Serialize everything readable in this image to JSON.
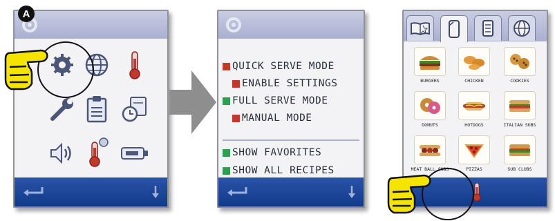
{
  "badge": "A",
  "screen2": {
    "menu_items": [
      {
        "label": "QUICK SERVE MODE",
        "color": "#c0392b",
        "indent": false
      },
      {
        "label": "ENABLE SETTINGS",
        "color": "#c0392b",
        "indent": true
      },
      {
        "label": "FULL SERVE MODE",
        "color": "#2e9e4f",
        "indent": false
      },
      {
        "label": "MANUAL MODE",
        "color": "#c0392b",
        "indent": true
      },
      {
        "label": "SHOW FAVORITES",
        "color": "#2e9e4f",
        "indent": false
      },
      {
        "label": "SHOW ALL RECIPES",
        "color": "#2e9e4f",
        "indent": false
      }
    ]
  },
  "screen3": {
    "recipes": [
      "BURGERS",
      "CHICKEN",
      "COOKIES",
      "DONUTS",
      "HOTDOGS",
      "ITALIAN SUBS",
      "MEAT BALL SUBS",
      "PIZZAS",
      "SUB CLUBS"
    ]
  },
  "colors": {
    "bar_blue": "#1a3f8f",
    "topbar": "#b9bed8",
    "hand": "#f5e400",
    "arrow": "#8e8e8e"
  },
  "icons": {
    "screen1": [
      "settings-gear-icon",
      "globe-icon",
      "thermometer-icon",
      "wrench-icon",
      "clipboard-icon",
      "timer-calendar-icon",
      "speaker-icon",
      "thermometer-probe-icon",
      "usb-drive-icon"
    ],
    "tabs": [
      "book-icon",
      "phone-icon",
      "document-icon",
      "globe-icon"
    ]
  }
}
